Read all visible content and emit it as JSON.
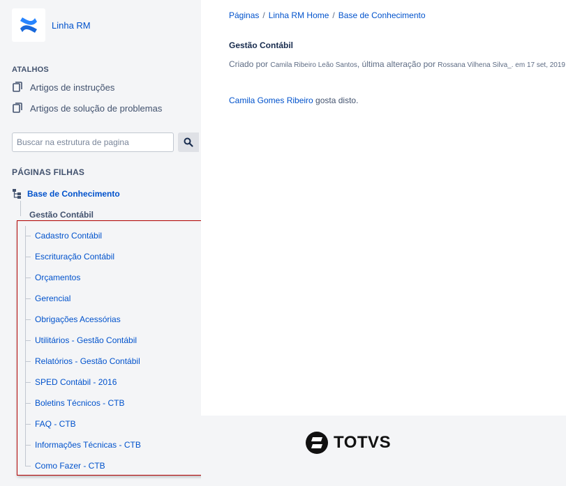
{
  "sidebar": {
    "space_name": "Linha RM",
    "shortcuts_title": "ATALHOS",
    "shortcuts": [
      {
        "label": "Artigos de instruções",
        "icon": "pages-icon"
      },
      {
        "label": "Artigos de solução de problemas",
        "icon": "pages-icon"
      }
    ],
    "search": {
      "placeholder": "Buscar na estrutura de pagina",
      "value": ""
    },
    "children_title": "PÁGINAS FILHAS",
    "tree": {
      "root": "Base de Conhecimento",
      "current": "Gestão Contábil",
      "children": [
        "Cadastro Contábil",
        "Escrituração Contábil",
        "Orçamentos",
        "Gerencial",
        "Obrigações Acessórias",
        "Utilitários - Gestão Contábil",
        "Relatórios - Gestão Contábil",
        "SPED Contábil - 2016",
        "Boletins Técnicos - CTB",
        "FAQ - CTB",
        "Informações Técnicas - CTB",
        "Como Fazer - CTB"
      ]
    },
    "highlight_color": "#b30000"
  },
  "breadcrumb": [
    "Páginas",
    "Linha RM Home",
    "Base de Conhecimento"
  ],
  "breadcrumb_separator": "/",
  "page": {
    "title": "Gestão Contábil",
    "meta": {
      "created_prefix": "Criado por ",
      "created_by": "Camila Ribeiro Leão Santos",
      "mid_text": ", última alteração por ",
      "modified_by": "Rossana Vilhena Silva_.",
      "date": " em 17 set, 2019"
    },
    "likes": {
      "user": "Camila Gomes Ribeiro",
      "text": " gosta disto."
    }
  },
  "footer": {
    "logo_text": "TOTVS"
  },
  "colors": {
    "link": "#0052cc",
    "sidebar_bg": "#f4f5f7",
    "confluence_blue": "#2684ff"
  }
}
